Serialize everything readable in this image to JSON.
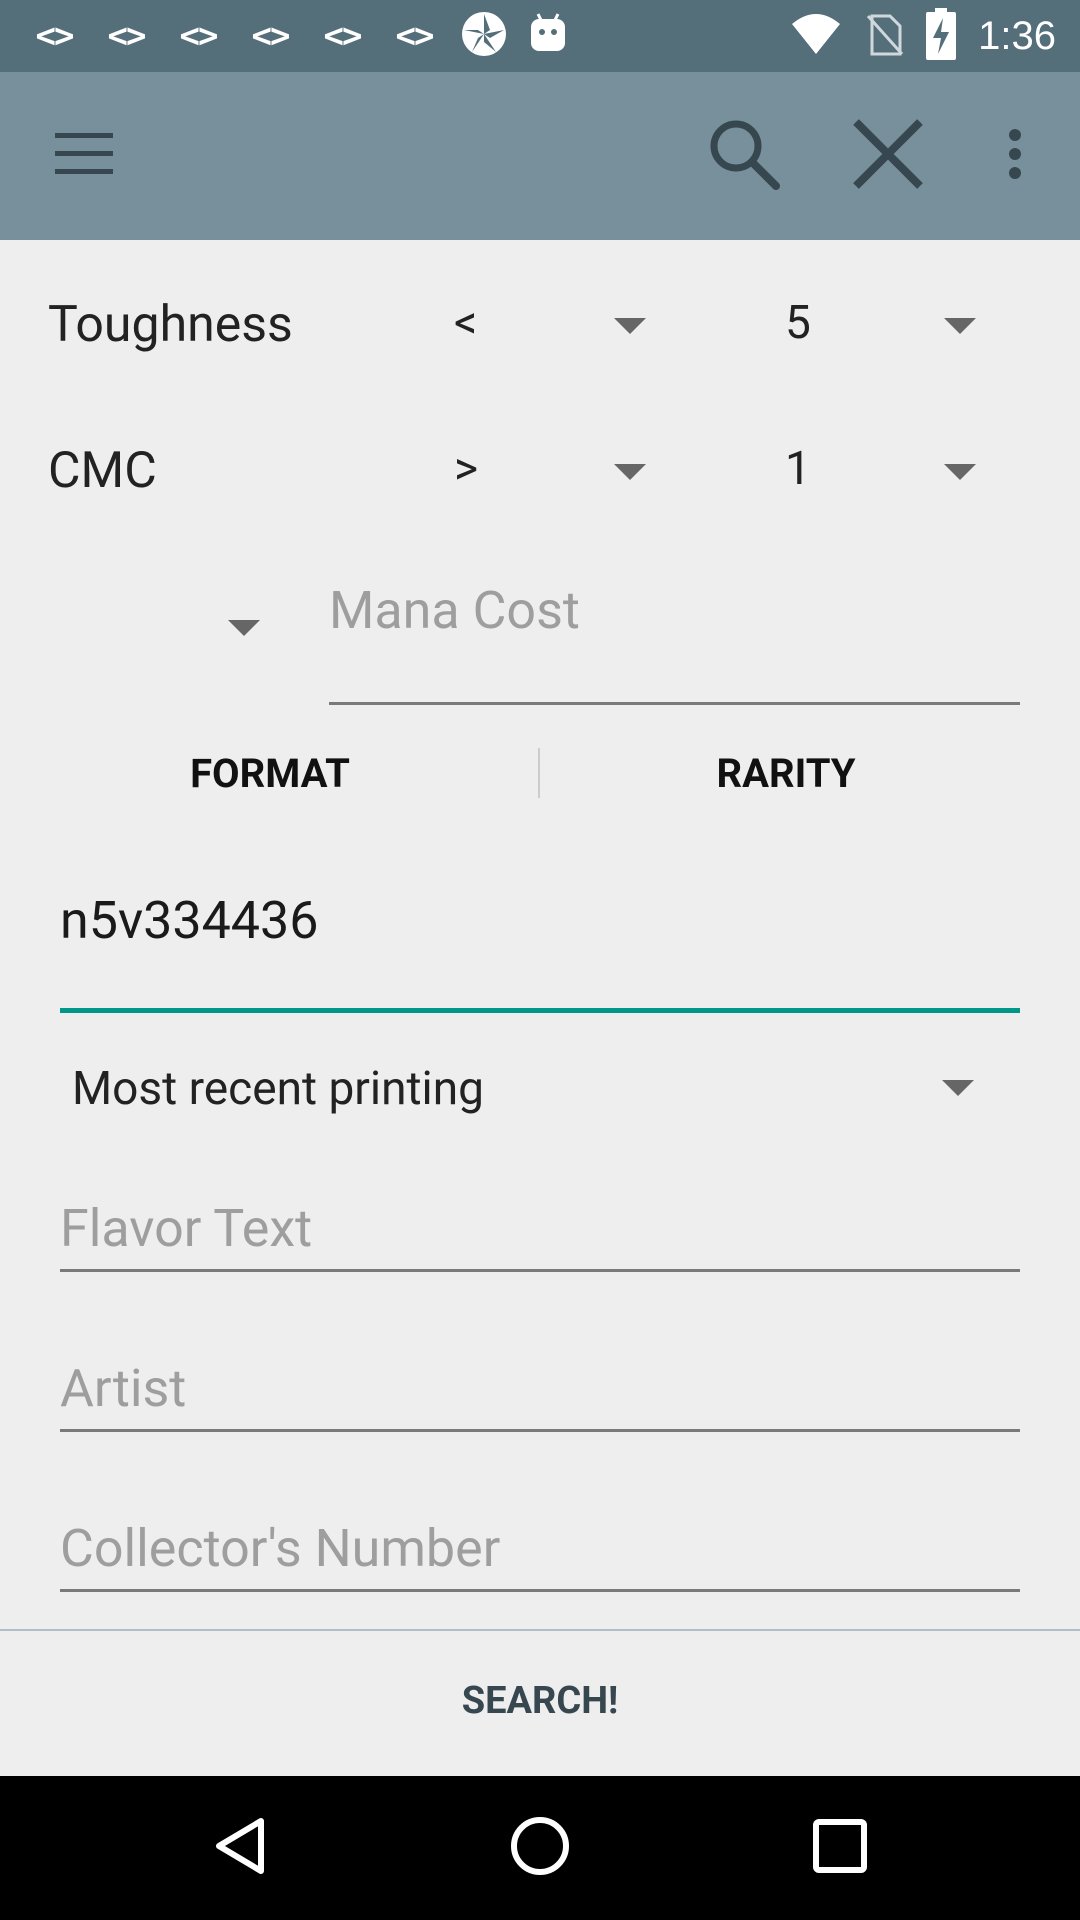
{
  "status_bar": {
    "time": "1:36",
    "left_icons": [
      "code-icon",
      "code-icon",
      "code-icon",
      "code-icon",
      "code-icon",
      "code-icon",
      "camera-shutter-icon",
      "android-icon"
    ],
    "code_glyph": "<>",
    "right_icons": [
      "wifi-icon",
      "no-sim-icon",
      "battery-charging-icon"
    ]
  },
  "app_bar": {
    "icons": [
      "menu-icon",
      "search-icon",
      "close-icon",
      "overflow-menu-icon"
    ]
  },
  "filters": {
    "toughness": {
      "label": "Toughness",
      "operator": "<",
      "value": "5"
    },
    "cmc": {
      "label": "CMC",
      "operator": ">",
      "value": "1"
    },
    "mana_cost": {
      "operator": "",
      "placeholder": "Mana Cost"
    }
  },
  "tabs": {
    "format": "FORMAT",
    "rarity": "RARITY"
  },
  "set_field": {
    "value": "n5v334436"
  },
  "printing": {
    "selected": "Most recent printing"
  },
  "text_fields": {
    "flavor_text": "Flavor Text",
    "artist": "Artist",
    "collectors_number": "Collector's Number"
  },
  "search_button": "SEARCH!",
  "nav_bar": {
    "icons": [
      "back-icon",
      "home-icon",
      "recents-icon"
    ]
  },
  "colors": {
    "status_bar": "#546e7a",
    "app_bar": "#78909c",
    "accent": "#009688",
    "background": "#eeeeee"
  }
}
